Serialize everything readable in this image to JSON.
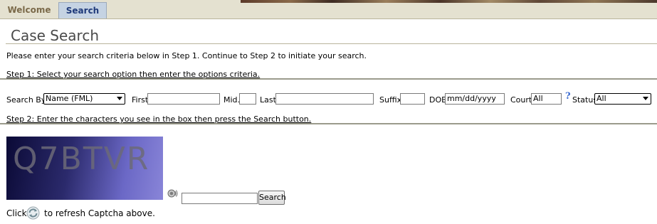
{
  "tabs": [
    {
      "label": "Welcome",
      "active": false
    },
    {
      "label": "Search",
      "active": true
    }
  ],
  "page_title": "Case Search",
  "intro": "Please enter your search criteria below in Step 1. Continue to Step 2 to initiate your search.",
  "step1": {
    "heading": "Step 1: Select your search option then enter the options criteria.",
    "search_by_label": "Search By:",
    "search_by_value": "Name (FML)",
    "first_label": "First",
    "first_value": "",
    "mid_label": "Mid.",
    "mid_value": "",
    "last_label": "Last",
    "last_value": "",
    "suffix_label": "Suffix",
    "suffix_value": "",
    "dob_label": "DOB",
    "dob_value": "mm/dd/yyyy",
    "court_label": "Court",
    "court_value": "All",
    "help_glyph": "?",
    "help_icon": "help-icon",
    "status_label": "Status",
    "status_value": "All"
  },
  "step2": {
    "heading": "Step 2: Enter the characters you see in the box then press the Search button.",
    "captcha_text": "Q7BTVR",
    "captcha_input_value": "",
    "audio_icon": "speaker-icon",
    "search_button_label": "Search",
    "refresh_prefix": "Click",
    "refresh_icon": "refresh-icon",
    "refresh_suffix": "to refresh Captcha above."
  },
  "colors": {
    "tab_bar": "#e4e1d0",
    "active_tab": "#c5d3e3",
    "active_tab_text": "#1f3a7a",
    "inactive_tab_text": "#7b6a4a",
    "help_icon": "#3a6bd1"
  }
}
